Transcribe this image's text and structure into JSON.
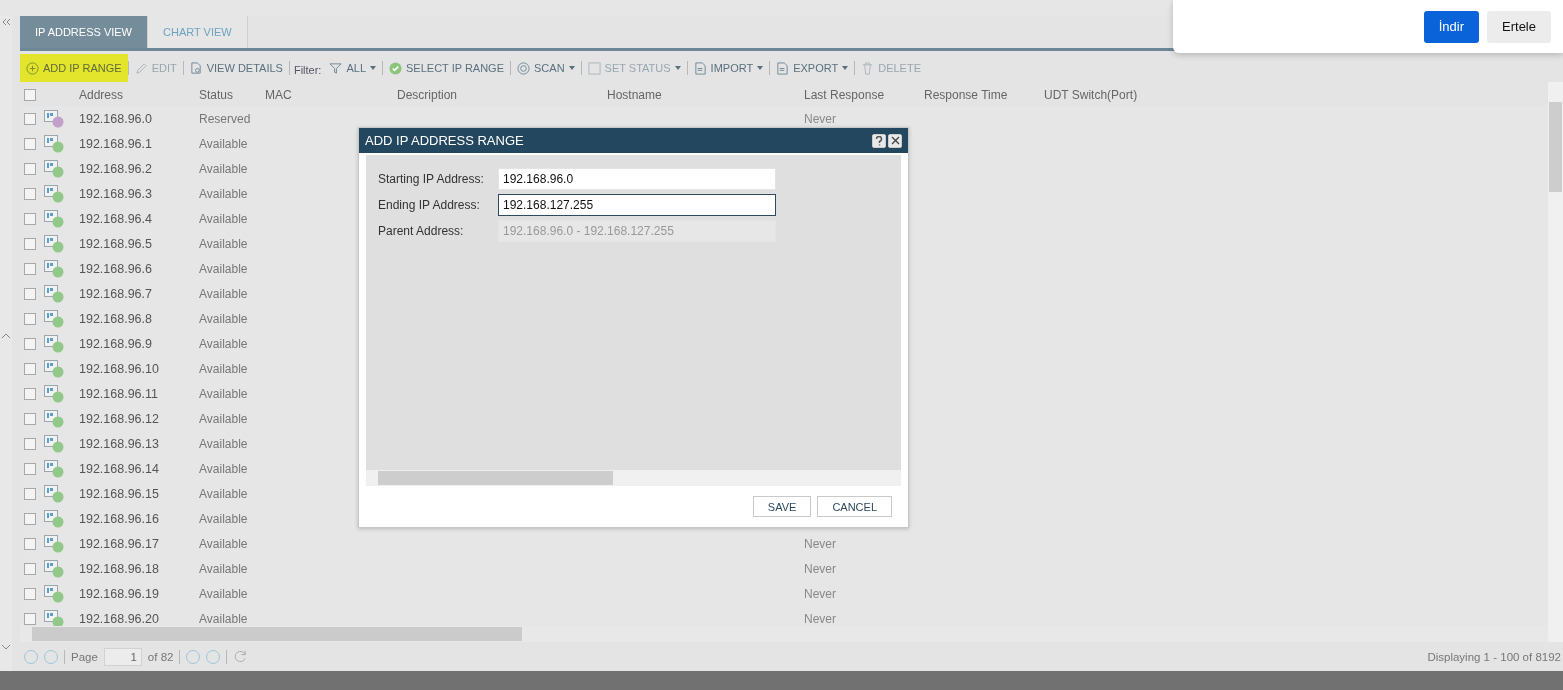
{
  "tabs": [
    {
      "label": "IP ADDRESS VIEW",
      "selected": true
    },
    {
      "label": "CHART VIEW",
      "selected": false
    }
  ],
  "toolbar": [
    {
      "label": "ADD IP RANGE",
      "disabled": false,
      "dropdown": false,
      "highlighted": true
    },
    {
      "label": "EDIT",
      "disabled": true,
      "dropdown": false,
      "highlighted": false
    },
    {
      "label": "VIEW DETAILS",
      "disabled": false,
      "dropdown": false,
      "highlighted": false
    },
    {
      "label": "Filter:",
      "kind": "label"
    },
    {
      "label": "ALL",
      "disabled": false,
      "dropdown": true,
      "highlighted": false
    },
    {
      "label": "SELECT IP RANGE",
      "disabled": false,
      "dropdown": false,
      "highlighted": false
    },
    {
      "label": "SCAN",
      "disabled": false,
      "dropdown": true,
      "highlighted": false
    },
    {
      "label": "SET STATUS",
      "disabled": true,
      "dropdown": true,
      "highlighted": false
    },
    {
      "label": "IMPORT",
      "disabled": false,
      "dropdown": true,
      "highlighted": false
    },
    {
      "label": "EXPORT",
      "disabled": false,
      "dropdown": true,
      "highlighted": false
    },
    {
      "label": "DELETE",
      "disabled": true,
      "dropdown": false,
      "highlighted": false
    }
  ],
  "table": {
    "select_all_checked": false,
    "columns": [
      "Address",
      "Status",
      "MAC",
      "Description",
      "Hostname",
      "Last Response",
      "Response Time",
      "UDT Switch(Port)"
    ],
    "rows": [
      {
        "address": "192.168.96.0",
        "status": "Reserved",
        "color": "#c39fcc",
        "checked": false,
        "last_response": "Never"
      },
      {
        "address": "192.168.96.1",
        "status": "Available",
        "color": "#92c98a",
        "checked": false
      },
      {
        "address": "192.168.96.2",
        "status": "Available",
        "color": "#92c98a",
        "checked": false
      },
      {
        "address": "192.168.96.3",
        "status": "Available",
        "color": "#92c98a",
        "checked": false
      },
      {
        "address": "192.168.96.4",
        "status": "Available",
        "color": "#92c98a",
        "checked": false
      },
      {
        "address": "192.168.96.5",
        "status": "Available",
        "color": "#92c98a",
        "checked": false
      },
      {
        "address": "192.168.96.6",
        "status": "Available",
        "color": "#92c98a",
        "checked": false
      },
      {
        "address": "192.168.96.7",
        "status": "Available",
        "color": "#92c98a",
        "checked": false
      },
      {
        "address": "192.168.96.8",
        "status": "Available",
        "color": "#92c98a",
        "checked": false
      },
      {
        "address": "192.168.96.9",
        "status": "Available",
        "color": "#92c98a",
        "checked": false
      },
      {
        "address": "192.168.96.10",
        "status": "Available",
        "color": "#92c98a",
        "checked": false
      },
      {
        "address": "192.168.96.11",
        "status": "Available",
        "color": "#92c98a",
        "checked": false
      },
      {
        "address": "192.168.96.12",
        "status": "Available",
        "color": "#92c98a",
        "checked": false
      },
      {
        "address": "192.168.96.13",
        "status": "Available",
        "color": "#92c98a",
        "checked": false
      },
      {
        "address": "192.168.96.14",
        "status": "Available",
        "color": "#92c98a",
        "checked": false
      },
      {
        "address": "192.168.96.15",
        "status": "Available",
        "color": "#92c98a",
        "checked": false
      },
      {
        "address": "192.168.96.16",
        "status": "Available",
        "color": "#92c98a",
        "checked": false
      },
      {
        "address": "192.168.96.17",
        "status": "Available",
        "color": "#92c98a",
        "checked": false,
        "last_response": "Never"
      },
      {
        "address": "192.168.96.18",
        "status": "Available",
        "color": "#92c98a",
        "checked": false,
        "last_response": "Never"
      },
      {
        "address": "192.168.96.19",
        "status": "Available",
        "color": "#92c98a",
        "checked": false,
        "last_response": "Never"
      },
      {
        "address": "192.168.96.20",
        "status": "Available",
        "color": "#92c98a",
        "checked": false,
        "last_response": "Never"
      }
    ]
  },
  "pager": {
    "page_label": "Page",
    "page": "1",
    "of": "of 82",
    "summary": "Displaying 1 - 100 of 8192"
  },
  "dialog": {
    "title": "ADD IP ADDRESS RANGE",
    "fields": [
      {
        "label": "Starting IP Address:",
        "value": "192.168.96.0",
        "focused": false,
        "disabled": false
      },
      {
        "label": "Ending IP Address:",
        "value": "192.168.127.255",
        "focused": true,
        "disabled": false
      },
      {
        "label": "Parent Address:",
        "value": "192.168.96.0 - 192.168.127.255",
        "focused": false,
        "disabled": true
      }
    ],
    "buttons": [
      "SAVE",
      "CANCEL"
    ]
  },
  "notification": {
    "buttons": [
      {
        "label": "İndir",
        "primary": true
      },
      {
        "label": "Ertele",
        "primary": false
      }
    ]
  }
}
